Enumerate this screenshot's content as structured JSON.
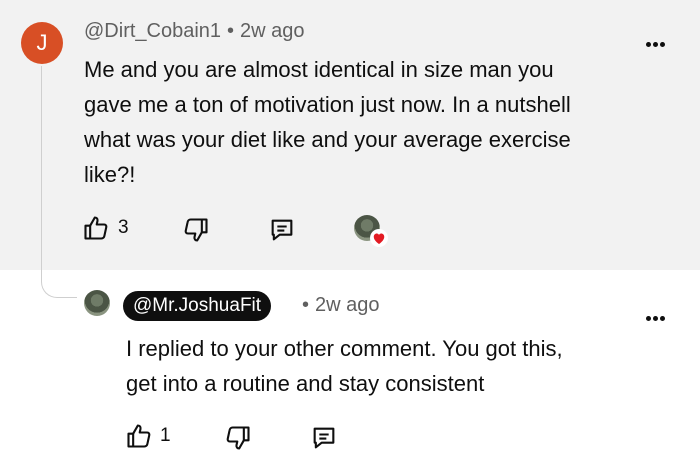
{
  "comment": {
    "avatar_letter": "J",
    "author": "@Dirt_Cobain1",
    "separator": "•",
    "time": "2w ago",
    "lines": [
      "Me and you are almost identical in size man you",
      "gave me a ton of motivation just now. In a nutshell",
      "what was your diet like and your average exercise",
      "like?!"
    ],
    "like_count": "3",
    "icons": {
      "like": "thumbs-up-icon",
      "dislike": "thumbs-down-icon",
      "reply": "reply-icon",
      "creator_heart": "heart-icon",
      "more": "more-options-icon"
    },
    "heart_color": "#e31b23"
  },
  "reply": {
    "author": "@Mr.JoshuaFit",
    "separator": "•",
    "time": "2w ago",
    "lines": [
      "I replied to your other comment. You got this,",
      "get into a routine and stay consistent"
    ],
    "like_count": "1"
  },
  "colors": {
    "avatar_accent": "#d84f25",
    "top_background": "#f2f2f2",
    "creator_chip": "#0f0f0f"
  }
}
